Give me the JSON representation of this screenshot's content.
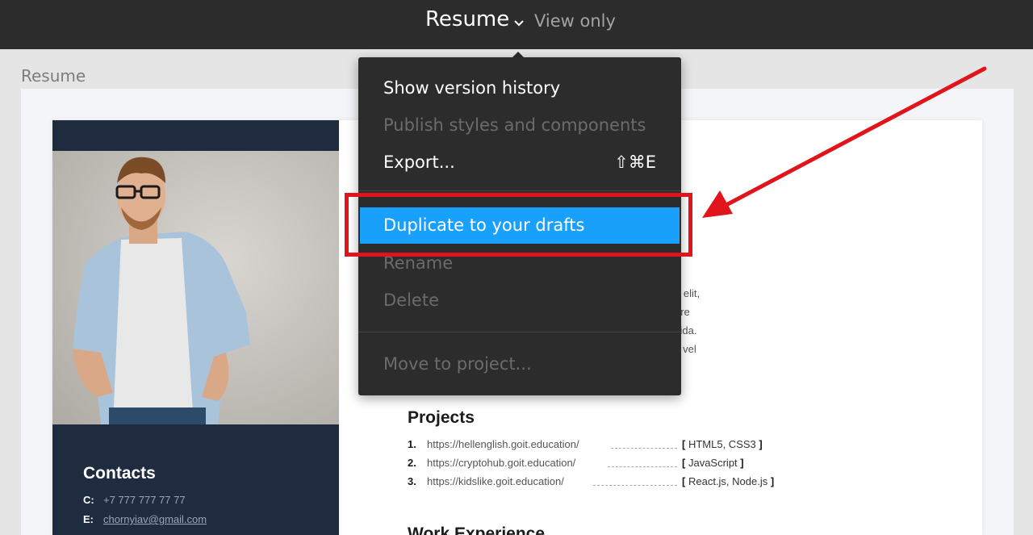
{
  "topbar": {
    "title": "Resume",
    "mode": "View only"
  },
  "canvas": {
    "frame_label": "Resume"
  },
  "resume": {
    "contacts_title": "Contacts",
    "contacts": [
      {
        "key": "C:",
        "value": "+7 777 777 77 77"
      },
      {
        "key": "E:",
        "value": "chornyiav@gmail.com"
      }
    ],
    "bg_text": [
      "g elit,",
      "ore",
      "vida.",
      "s vel"
    ],
    "projects_title": "Projects",
    "projects": [
      {
        "num": "1.",
        "url": "https://hellenglish.goit.education/",
        "tech": "HTML5, CSS3"
      },
      {
        "num": "2.",
        "url": "https://cryptohub.goit.education/",
        "tech": "JavaScript"
      },
      {
        "num": "3.",
        "url": "https://kidslike.goit.education/",
        "tech": "React.js, Node.js"
      }
    ],
    "work_title": "Work Experience"
  },
  "menu": {
    "items": [
      {
        "label": "Show version history",
        "disabled": false
      },
      {
        "label": "Publish styles and components",
        "disabled": true
      },
      {
        "label": "Export...",
        "shortcut": "⇧⌘E",
        "disabled": false
      },
      {
        "label": "Duplicate to your drafts",
        "active": true
      },
      {
        "label": "Rename",
        "disabled": true
      },
      {
        "label": "Delete",
        "disabled": true
      },
      {
        "label": "Move to project...",
        "disabled": true
      }
    ]
  },
  "colors": {
    "topbar": "#2c2c2c",
    "menu_bg": "#2c2c2c",
    "menu_active": "#18a0fb",
    "annotation": "#e0141a",
    "resume_sidebar": "#1f2c3f"
  }
}
